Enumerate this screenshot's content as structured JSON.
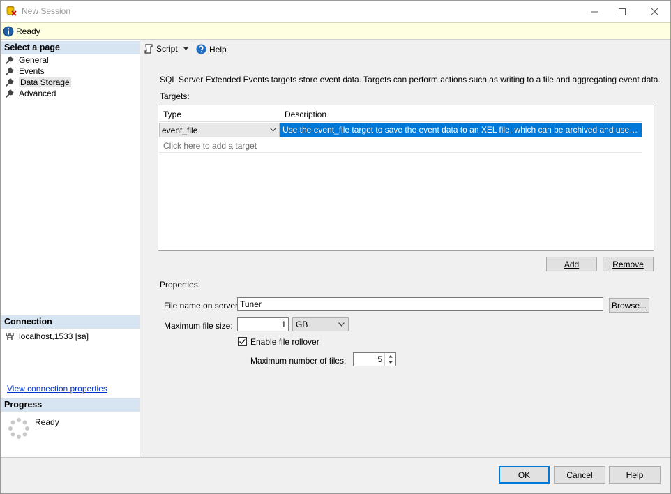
{
  "window": {
    "title": "New Session",
    "status": "Ready"
  },
  "left": {
    "select_page_header": "Select a page",
    "pages": [
      {
        "label": "General"
      },
      {
        "label": "Events"
      },
      {
        "label": "Data Storage"
      },
      {
        "label": "Advanced"
      }
    ],
    "connection_header": "Connection",
    "connection_value": "localhost,1533 [sa]",
    "view_connection_link": "View connection properties",
    "progress_header": "Progress",
    "progress_status": "Ready"
  },
  "toolbar": {
    "script_label": "Script",
    "help_label": "Help"
  },
  "main": {
    "description": "SQL Server Extended Events targets store event data. Targets can perform actions such as writing to a file and aggregating event data.",
    "targets_label": "Targets:",
    "grid": {
      "columns": [
        "Type",
        "Description"
      ],
      "rows": [
        {
          "type": "event_file",
          "description": "Use the event_file target to save the event data to an XEL file, which can be archived and used for later an..."
        }
      ],
      "add_placeholder": "Click here to add a target"
    },
    "add_button": "Add",
    "remove_button": "Remove",
    "properties_label": "Properties:",
    "file_name_label": "File name on server:",
    "file_name_value": "Tuner",
    "browse_button": "Browse...",
    "max_file_size_label": "Maximum file size:",
    "max_file_size_value": "1",
    "size_unit": "GB",
    "rollover_label": "Enable file rollover",
    "rollover_checked": true,
    "max_files_label": "Maximum number of files:",
    "max_files_value": "5"
  },
  "footer": {
    "ok_button": "OK",
    "cancel_button": "Cancel",
    "help_button": "Help"
  },
  "colors": {
    "selection": "#0078d7",
    "status_bg": "#ffffe1",
    "section_header_bg": "#d7e4f2"
  }
}
